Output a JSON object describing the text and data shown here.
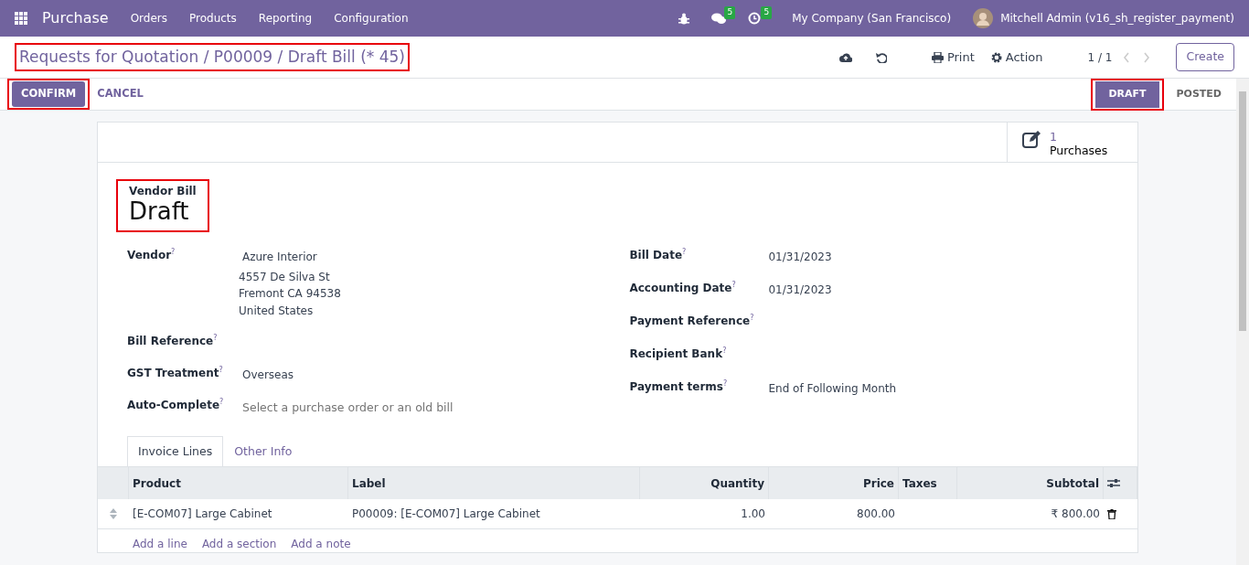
{
  "navbar": {
    "app": "Purchase",
    "menu": [
      "Orders",
      "Products",
      "Reporting",
      "Configuration"
    ],
    "messages_badge": "5",
    "activities_badge": "5",
    "company": "My Company (San Francisco)",
    "user": "Mitchell Admin (v16_sh_register_payment)"
  },
  "control_panel": {
    "breadcrumb": {
      "text": "Requests for Quotation / P00009 / Draft Bill (* 45)",
      "highlighted": true
    },
    "print": "Print",
    "action": "Action",
    "pager": "1 / 1",
    "create": "Create"
  },
  "status_bar": {
    "buttons": [
      {
        "label": "CONFIRM",
        "kind": "primary",
        "highlighted": true
      },
      {
        "label": "CANCEL",
        "kind": "link",
        "highlighted": false
      }
    ],
    "stages": [
      {
        "label": "DRAFT",
        "selected": true,
        "highlighted": true
      },
      {
        "label": "POSTED",
        "selected": false,
        "highlighted": false
      }
    ]
  },
  "smart_button": {
    "count": "1",
    "label": "Purchases"
  },
  "title": {
    "subtitle": "Vendor Bill",
    "name": "Draft",
    "highlighted": true
  },
  "fields_left": [
    {
      "label": "Vendor",
      "help": "?",
      "value": "Azure Interior",
      "address": [
        "4557 De Silva St",
        "Fremont CA 94538",
        "United States"
      ]
    },
    {
      "label": "Bill Reference",
      "help": "?"
    },
    {
      "label": "GST Treatment",
      "help": "?",
      "value": "Overseas"
    },
    {
      "label": "Auto-Complete",
      "help": "?",
      "placeholder": "Select a purchase order or an old bill"
    }
  ],
  "fields_right": [
    {
      "label": "Bill Date",
      "help": "?",
      "value": "01/31/2023"
    },
    {
      "label": "Accounting Date",
      "help": "?",
      "value": "01/31/2023"
    },
    {
      "label": "Payment Reference",
      "help": "?"
    },
    {
      "label": "Recipient Bank",
      "help": "?"
    },
    {
      "label": "Payment terms",
      "help": "?",
      "value": "End of Following Month"
    }
  ],
  "tabs": [
    {
      "label": "Invoice Lines",
      "selected": true
    },
    {
      "label": "Other Info",
      "selected": false
    }
  ],
  "table": {
    "columns": [
      "Product",
      "Label",
      "Quantity",
      "Price",
      "Taxes",
      "Subtotal"
    ],
    "rows": [
      [
        "[E-COM07] Large Cabinet",
        "P00009: [E-COM07] Large Cabinet",
        "1.00",
        "800.00",
        "",
        "₹ 800.00"
      ]
    ],
    "add_links": [
      "Add a line",
      "Add a section",
      "Add a note"
    ]
  }
}
